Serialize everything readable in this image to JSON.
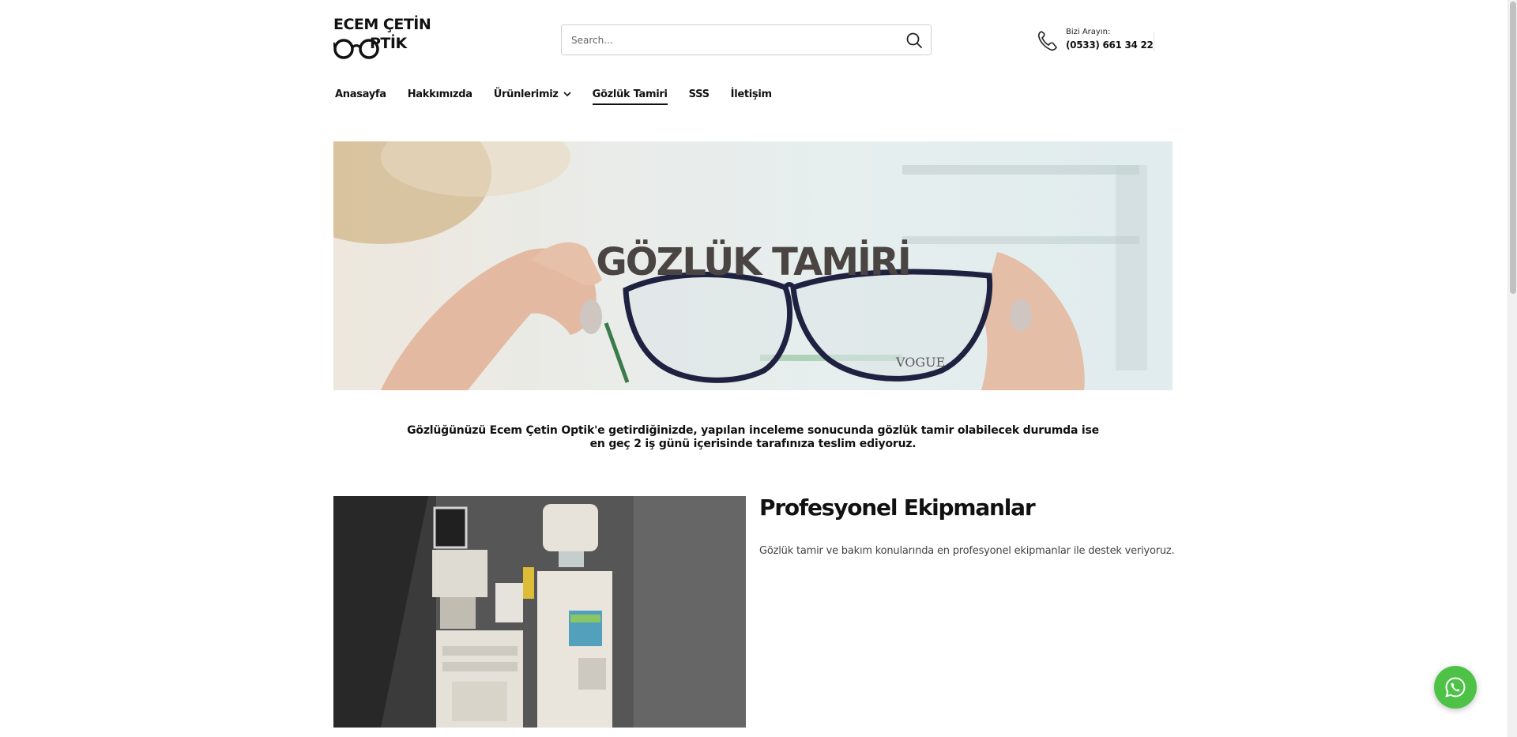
{
  "header": {
    "logo_line1": "ECEM ÇETİN",
    "logo_line2": "PTİK",
    "search_placeholder": "Search...",
    "contact_label": "Bizi Arayın:",
    "contact_number": "(0533) 661 34 22"
  },
  "nav": {
    "items": [
      {
        "label": "Anasayfa"
      },
      {
        "label": "Hakkımızda"
      },
      {
        "label": "Ürünlerimiz",
        "has_dropdown": true
      },
      {
        "label": "Gözlük Tamiri",
        "active": true
      },
      {
        "label": "SSS"
      },
      {
        "label": "İletişim"
      }
    ]
  },
  "hero": {
    "title": "GÖZLÜK TAMİRİ",
    "brand_on_glasses": "VOGUE"
  },
  "intro": {
    "line1": "Gözlüğünüzü Ecem Çetin Optik'e getirdiğinizde, yapılan inceleme sonucunda gözlük tamir olabilecek durumda ise",
    "line2": "en geç 2 iş günü içerisinde tarafınıza teslim ediyoruz."
  },
  "feature": {
    "title": "Profesyonel Ekipmanlar",
    "text": "Gözlük tamir ve bakım konularında en profesyonel ekipmanlar ile destek veriyoruz."
  },
  "colors": {
    "accent_whatsapp": "#4dc247",
    "text_primary": "#111111",
    "hero_title": "#4a4542"
  },
  "icons": {
    "search": "search-icon",
    "phone": "phone-icon",
    "dropdown": "chevron-down-icon",
    "whatsapp": "whatsapp-icon"
  }
}
